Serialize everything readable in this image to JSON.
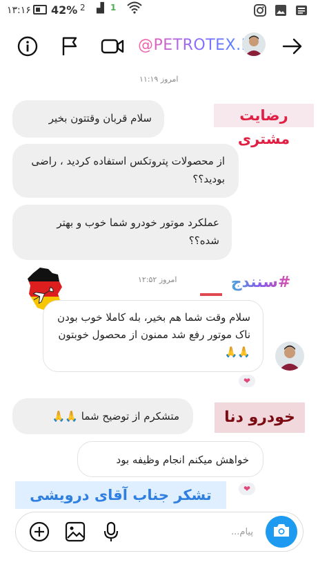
{
  "status_bar": {
    "time": "۱۳:۱۶",
    "battery": "42%",
    "sim_slot": "2",
    "data_slot": "1"
  },
  "header": {
    "handle": "@PETROTEX.IR"
  },
  "thread": {
    "timestamp_1": "امروز ۱۱:۱۹",
    "timestamp_2": "امروز ۱۲:۵۲",
    "messages": [
      "سلام قربان وقتتون بخیر",
      "از محصولات پتروتکس استفاده کردید ، راضی بودید؟؟",
      "عملکرد موتور خودرو شما خوب و بهتر شده؟؟",
      "سلام وقت شما هم بخیر، بله کاملا خوب بودن ناک موتور رفع شد ممنون از محصول خوبتون🙏🙏",
      "متشکرم از توضیح شما 🙏🙏",
      "خواهش میکنم انجام وظیفه بود"
    ]
  },
  "overlays": {
    "satisfaction_tag": "رضایت مشتری",
    "city_hashtag": "#سنندج",
    "car_tag": "خودرو دنا",
    "thanks_tag": "تشکر جناب آقای درویشی"
  },
  "composer": {
    "placeholder": "پیام..."
  }
}
